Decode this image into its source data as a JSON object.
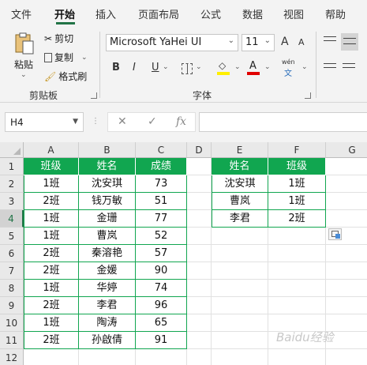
{
  "menu": {
    "tabs": [
      "文件",
      "开始",
      "插入",
      "页面布局",
      "公式",
      "数据",
      "视图",
      "帮助"
    ],
    "active_tab": "开始"
  },
  "ribbon": {
    "clipboard": {
      "paste_label": "粘贴",
      "cut_label": "剪切",
      "copy_label": "复制",
      "format_painter_label": "格式刷",
      "group_label": "剪贴板"
    },
    "font": {
      "font_name": "Microsoft YaHei UI",
      "font_size": "11",
      "increase_size": "A",
      "decrease_size": "A",
      "bold": "B",
      "italic": "I",
      "underline": "U",
      "font_color_letter": "A",
      "phonetic_top": "wén",
      "phonetic_bottom": "文",
      "group_label": "字体",
      "fill_color": "#ffef00",
      "font_color": "#e00000"
    }
  },
  "formula_bar": {
    "name_box": "H4",
    "cancel_symbol": "✕",
    "enter_symbol": "✓",
    "function_symbol": "fx",
    "formula": ""
  },
  "grid": {
    "columns": [
      "A",
      "B",
      "C",
      "D",
      "E",
      "F",
      "G"
    ],
    "rows": [
      "1",
      "2",
      "3",
      "4",
      "5",
      "6",
      "7",
      "8",
      "9",
      "10",
      "11",
      "12"
    ],
    "selected_row": "4",
    "table1": {
      "headers": [
        "班级",
        "姓名",
        "成绩"
      ],
      "rows": [
        [
          "1班",
          "沈安琪",
          "73"
        ],
        [
          "2班",
          "钱万敏",
          "51"
        ],
        [
          "1班",
          "金珊",
          "77"
        ],
        [
          "1班",
          "曹岚",
          "52"
        ],
        [
          "2班",
          "秦溶艳",
          "57"
        ],
        [
          "2班",
          "金媛",
          "90"
        ],
        [
          "1班",
          "华婷",
          "74"
        ],
        [
          "2班",
          "李君",
          "96"
        ],
        [
          "1班",
          "陶涛",
          "65"
        ],
        [
          "2班",
          "孙啟倩",
          "91"
        ]
      ]
    },
    "table2": {
      "headers": [
        "姓名",
        "班级"
      ],
      "rows": [
        [
          "沈安琪",
          "1班"
        ],
        [
          "曹岚",
          "1班"
        ],
        [
          "李君",
          "2班"
        ]
      ]
    },
    "accent_color": "#11a650",
    "watermark": "Baidu经验"
  }
}
